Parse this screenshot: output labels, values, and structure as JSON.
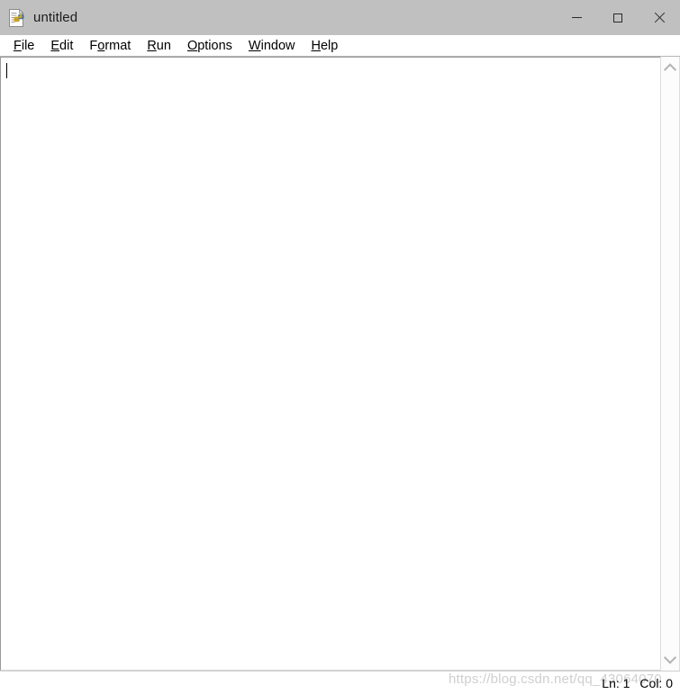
{
  "window": {
    "title": "untitled",
    "icon": "python-idle-document-icon",
    "titlebar_color": "#c0c0c0",
    "controls": {
      "minimize_label": "Minimize",
      "maximize_label": "Maximize",
      "close_label": "Close"
    }
  },
  "menubar": {
    "items": [
      {
        "label": "File",
        "before": "",
        "accel": "F",
        "after": "ile"
      },
      {
        "label": "Edit",
        "before": "",
        "accel": "E",
        "after": "dit"
      },
      {
        "label": "Format",
        "before": "F",
        "accel": "o",
        "after": "rmat"
      },
      {
        "label": "Run",
        "before": "",
        "accel": "R",
        "after": "un"
      },
      {
        "label": "Options",
        "before": "",
        "accel": "O",
        "after": "ptions"
      },
      {
        "label": "Window",
        "before": "",
        "accel": "W",
        "after": "indow"
      },
      {
        "label": "Help",
        "before": "",
        "accel": "H",
        "after": "elp"
      }
    ]
  },
  "editor": {
    "content": "",
    "placeholder": "",
    "caret_visible": true
  },
  "scrollbar": {
    "up_arrow": "chevron-up-icon",
    "down_arrow": "chevron-down-icon"
  },
  "statusbar": {
    "line_label": "Ln: 1",
    "column_label": "Col: 0"
  },
  "watermark": {
    "text": "https://blog.csdn.net/qq_43064070",
    "color": "#cfcfcf"
  }
}
